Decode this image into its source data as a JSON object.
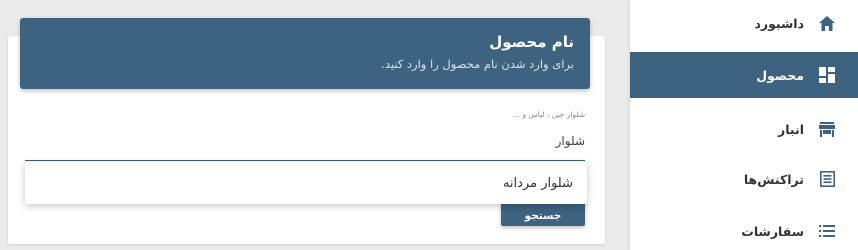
{
  "sidebar": {
    "items": [
      {
        "label": "داشبورد",
        "icon": "home-icon",
        "active": false
      },
      {
        "label": "محصول",
        "icon": "dashboard-grid-icon",
        "active": true
      },
      {
        "label": "انبار",
        "icon": "store-icon",
        "active": false
      },
      {
        "label": "تراکنش‌ها",
        "icon": "receipt-icon",
        "active": false
      },
      {
        "label": "سفارشات",
        "icon": "list-icon",
        "active": false
      }
    ]
  },
  "product_form": {
    "title": "نام محصول",
    "subtitle": "برای وارد شدن نام محصول را وارد کنید.",
    "hint": "شلوار جین ، لباس و ...",
    "field_label": "شلوار",
    "suggestion": "شلوار مردانه",
    "search_button": "جستجو"
  },
  "colors": {
    "accent": "#3d6380",
    "background": "#ebebeb",
    "card": "#ffffff"
  }
}
